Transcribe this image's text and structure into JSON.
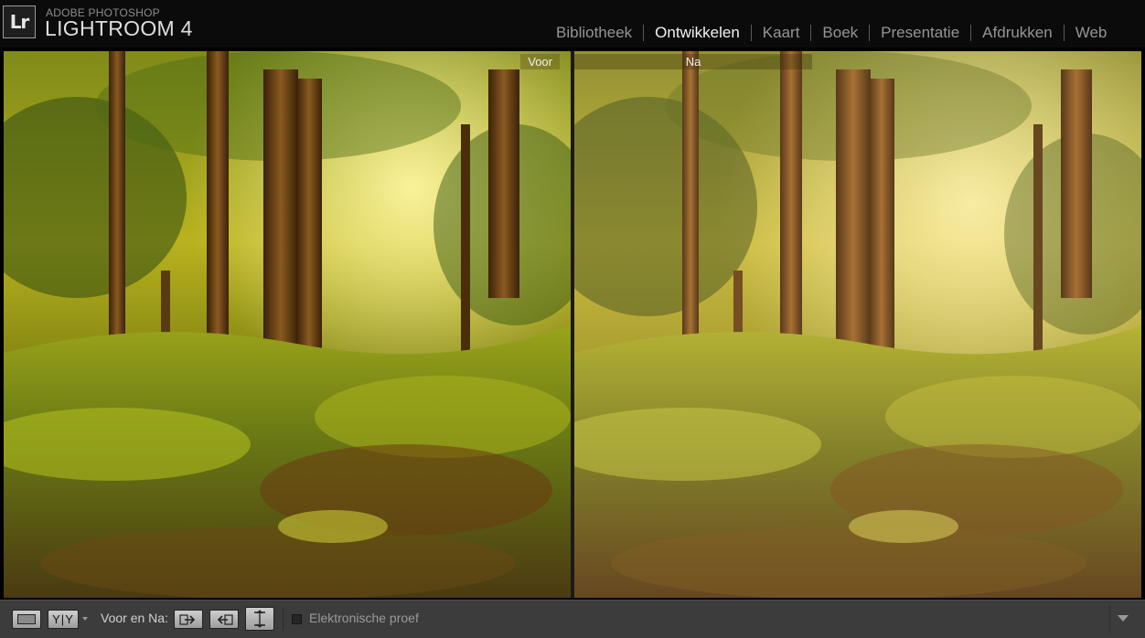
{
  "app": {
    "logo_text": "Lr",
    "brand_top": "ADOBE PHOTOSHOP",
    "brand_main": "LIGHTROOM 4"
  },
  "modules": [
    {
      "label": "Bibliotheek",
      "active": false
    },
    {
      "label": "Ontwikkelen",
      "active": true
    },
    {
      "label": "Kaart",
      "active": false
    },
    {
      "label": "Boek",
      "active": false
    },
    {
      "label": "Presentatie",
      "active": false
    },
    {
      "label": "Afdrukken",
      "active": false
    },
    {
      "label": "Web",
      "active": false
    }
  ],
  "viewer": {
    "before_label": "Voor",
    "after_label": "Na",
    "photo_before_icon": "forest-photo-before",
    "photo_after_icon": "forest-photo-after"
  },
  "toolbar": {
    "loupe_icon": "loupe-view-icon",
    "yy_label": "Y|Y",
    "before_after_label": "Voor en Na:",
    "swap_icon_1": "copy-settings-before-to-after-icon",
    "swap_icon_2": "copy-settings-after-to-before-icon",
    "swap_icon_3": "swap-before-after-icon",
    "soft_proof_label": "Elektronische proef",
    "soft_proof_checked": false,
    "toolbar_menu_icon": "toolbar-content-menu-icon"
  },
  "colors": {
    "topbar_bg": "#0b0b0b",
    "toolbar_bg": "#3c3c3c",
    "active_module": "#f2f2f2",
    "inactive_module": "#959595"
  }
}
